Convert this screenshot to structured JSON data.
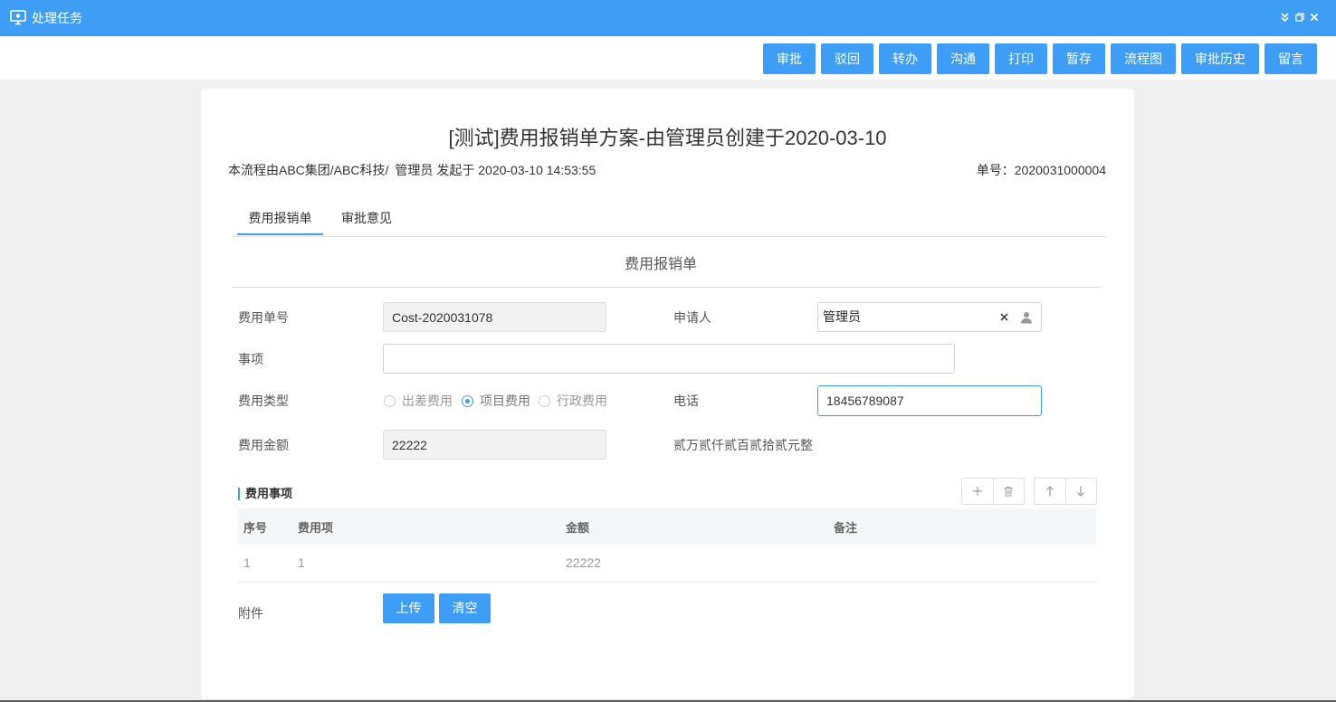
{
  "theme": {
    "accent": "#3e9df4",
    "background": "#efefef"
  },
  "window": {
    "title": "处理任务",
    "icons": {
      "app": "monitor-icon",
      "collapse": "double-chevron-down-icon",
      "restore": "restore-icon",
      "close": "close-icon"
    }
  },
  "toolbar": {
    "buttons": [
      "审批",
      "驳回",
      "转办",
      "沟通",
      "打印",
      "暂存",
      "流程图",
      "审批历史",
      "留言"
    ]
  },
  "header": {
    "title": "[测试]费用报销单方案-由管理员创建于2020-03-10",
    "flow_prefix": "本流程由ABC集团/ABC科技/",
    "flow_initiator": "管理员",
    "flow_started": "发起于 2020-03-10 14:53:55",
    "order_label": "单号：",
    "order_no": "2020031000004"
  },
  "tabs": [
    {
      "label": "费用报销单",
      "active": true
    },
    {
      "label": "审批意见",
      "active": false
    }
  ],
  "form": {
    "title": "费用报销单",
    "cost_no": {
      "label": "费用单号",
      "value": "Cost-2020031078",
      "disabled": true
    },
    "applicant": {
      "label": "申请人",
      "value": "管理员",
      "icons": [
        "clear-icon",
        "user-icon"
      ]
    },
    "subject": {
      "label": "事项",
      "value": ""
    },
    "cost_type": {
      "label": "费用类型",
      "options": [
        "出差费用",
        "项目费用",
        "行政费用"
      ],
      "selected": "项目费用"
    },
    "phone": {
      "label": "电话",
      "value": "18456789087",
      "focused": true
    },
    "amount": {
      "label": "费用金额",
      "value": "22222",
      "disabled": true
    },
    "amount_in_words": "贰万贰仟贰百贰拾贰元整"
  },
  "items": {
    "title": "费用事项",
    "tools": [
      "plus-icon",
      "trash-icon",
      "arrow-up-icon",
      "arrow-down-icon"
    ],
    "columns": [
      "序号",
      "费用项",
      "金额",
      "备注"
    ],
    "rows": [
      {
        "index": "1",
        "item": "1",
        "amount": "22222",
        "remark": ""
      }
    ]
  },
  "attachment": {
    "label": "附件",
    "buttons": [
      "上传",
      "清空"
    ]
  }
}
